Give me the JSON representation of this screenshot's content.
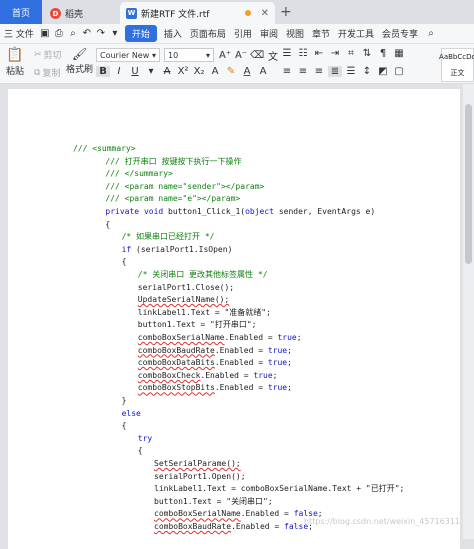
{
  "tabs": {
    "home": "首页",
    "daoke": "稻壳",
    "doc": "新建RTF 文件.rtf"
  },
  "menu": [
    "三 文件",
    "开始",
    "插入",
    "页面布局",
    "引用",
    "审阅",
    "视图",
    "章节",
    "开发工具",
    "会员专享"
  ],
  "toolbar": {
    "paste": "粘贴",
    "cut": "剪切",
    "copy": "复制",
    "format_painter": "格式刷",
    "font_name": "Courier New",
    "font_size": "10",
    "style_preview": "AaBbCcDd",
    "style_name": "正文"
  },
  "code": [
    {
      "indent": 0,
      "text": "/// <summary>",
      "cls": "cm"
    },
    {
      "indent": 4,
      "text": "/// 打开串口 按键按下执行一下操作",
      "cls": "cm"
    },
    {
      "indent": 4,
      "text": "/// </summary>",
      "cls": "cm"
    },
    {
      "indent": 4,
      "text": "/// <param name=\"sender\"></param>",
      "cls": "cm"
    },
    {
      "indent": 4,
      "text": "/// <param name=\"e\"></param>",
      "cls": "cm"
    },
    {
      "indent": 4,
      "text": "private void button1_Click_1(object sender, EventArgs e)",
      "cls": "mixed1"
    },
    {
      "indent": 4,
      "text": "{",
      "cls": ""
    },
    {
      "indent": 6,
      "text": "/* 如果串口已经打开 */",
      "cls": "cm"
    },
    {
      "indent": 6,
      "text": "if (serialPort1.IsOpen)",
      "cls": "mixed2"
    },
    {
      "indent": 6,
      "text": "{",
      "cls": ""
    },
    {
      "indent": 8,
      "text": "/* 关闭串口 更改其他标签属性 */",
      "cls": "cm"
    },
    {
      "indent": 8,
      "text": "serialPort1.Close();",
      "cls": ""
    },
    {
      "indent": 8,
      "text": "UpdateSerialName();",
      "cls": "rd"
    },
    {
      "indent": 8,
      "text": "linkLabel1.Text = \"准备就绪\";",
      "cls": ""
    },
    {
      "indent": 8,
      "text": "button1.Text = \"打开串口\";",
      "cls": ""
    },
    {
      "indent": 8,
      "text": "comboBoxSerialName.Enabled = true;",
      "cls": "mixed3"
    },
    {
      "indent": 8,
      "text": "comboBoxBaudRate.Enabled = true;",
      "cls": "mixed3"
    },
    {
      "indent": 8,
      "text": "comboBoxDataBits.Enabled = true;",
      "cls": "mixed3"
    },
    {
      "indent": 8,
      "text": "comboBoxCheck.Enabled = true;",
      "cls": "mixed3"
    },
    {
      "indent": 8,
      "text": "comboBoxStopBits.Enabled = true;",
      "cls": "mixed3"
    },
    {
      "indent": 6,
      "text": "}",
      "cls": ""
    },
    {
      "indent": 6,
      "text": "else",
      "cls": "kw"
    },
    {
      "indent": 6,
      "text": "{",
      "cls": ""
    },
    {
      "indent": 8,
      "text": "try",
      "cls": "kw"
    },
    {
      "indent": 8,
      "text": "{",
      "cls": ""
    },
    {
      "indent": 10,
      "text": "SetSerialParame();",
      "cls": "rd"
    },
    {
      "indent": 10,
      "text": "serialPort1.Open();",
      "cls": ""
    },
    {
      "indent": 10,
      "text": "linkLabel1.Text = comboBoxSerialName.Text + \"已打开\";",
      "cls": ""
    },
    {
      "indent": 10,
      "text": "button1.Text = \"关闭串口\";",
      "cls": ""
    },
    {
      "indent": 10,
      "text": "comboBoxSerialName.Enabled = false;",
      "cls": "mixed3"
    },
    {
      "indent": 10,
      "text": "comboBoxBaudRate.Enabled = false;",
      "cls": "mixed3"
    }
  ],
  "watermark": "https://blog.csdn.net/weixin_45716311"
}
